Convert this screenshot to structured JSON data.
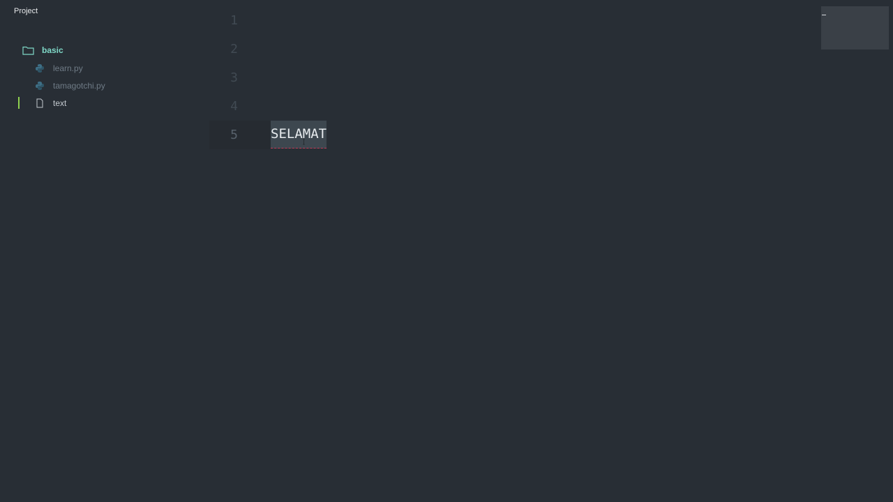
{
  "sidebar": {
    "title": "Project",
    "folder": {
      "name": "basic",
      "icon": "folder-icon"
    },
    "files": [
      {
        "name": "learn.py",
        "icon": "python-icon",
        "active": false
      },
      {
        "name": "tamagotchi.py",
        "icon": "python-icon",
        "active": false
      },
      {
        "name": "text",
        "icon": "file-icon",
        "active": true
      }
    ]
  },
  "editor": {
    "line_numbers": [
      "1",
      "2",
      "3",
      "4",
      "5"
    ],
    "current_line": 5,
    "lines": [
      "",
      "",
      "",
      "",
      "SELAMAT"
    ],
    "selected_text": "SELAMAT"
  },
  "colors": {
    "background": "#282e35",
    "folder_accent": "#7fd8c7",
    "active_marker": "#8fd14f",
    "selection": "#3d474f",
    "spell_underline": "#c23a56"
  }
}
